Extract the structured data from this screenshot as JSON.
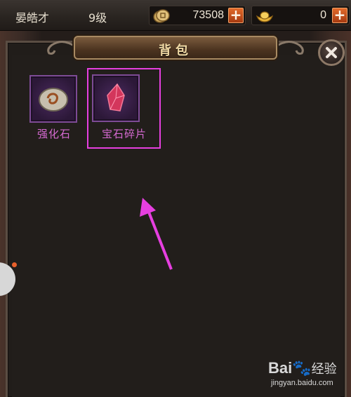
{
  "player": {
    "name": "晏皓才",
    "level": "9级"
  },
  "resources": {
    "coins": {
      "value": "73508",
      "icon": "coin-icon",
      "add_icon": "plus-icon"
    },
    "ingots": {
      "value": "0",
      "icon": "gold-ingot-icon",
      "add_icon": "plus-icon"
    }
  },
  "bag": {
    "title": "背包",
    "close_icon": "close-icon",
    "items": [
      {
        "label": "强化石",
        "icon": "enhance-stone-icon"
      },
      {
        "label": "宝石碎片",
        "icon": "gem-fragment-icon",
        "highlighted": true
      }
    ]
  },
  "annotation": {
    "color": "#e63fe0",
    "icon": "arrow-icon"
  },
  "watermark": {
    "logo_latin": "Bai",
    "logo_cn": "经验",
    "url": "jingyan.baidu.com"
  }
}
